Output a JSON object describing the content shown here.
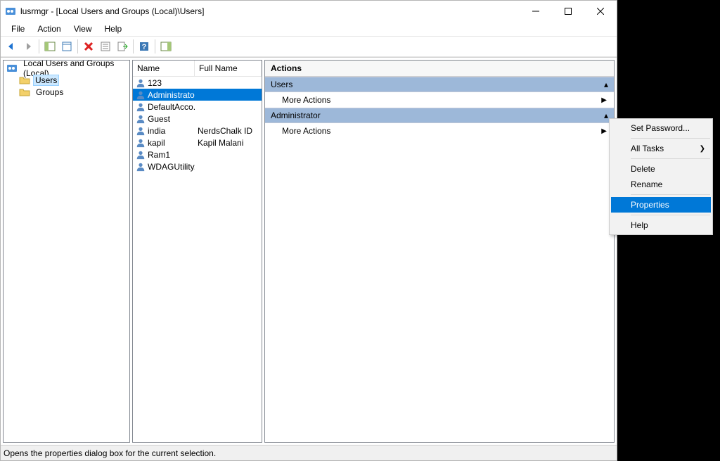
{
  "window_title": "lusrmgr - [Local Users and Groups (Local)\\Users]",
  "menu": {
    "file": "File",
    "action": "Action",
    "view": "View",
    "help": "Help"
  },
  "tree": {
    "root": "Local Users and Groups (Local)",
    "users": "Users",
    "groups": "Groups"
  },
  "list": {
    "headers": {
      "name": "Name",
      "full_name": "Full Name"
    },
    "rows": [
      {
        "name": "123",
        "full": ""
      },
      {
        "name": "Administrator",
        "full": ""
      },
      {
        "name": "DefaultAcco...",
        "full": ""
      },
      {
        "name": "Guest",
        "full": ""
      },
      {
        "name": "india",
        "full": "NerdsChalk ID"
      },
      {
        "name": "kapil",
        "full": "Kapil Malani"
      },
      {
        "name": "Ram1",
        "full": ""
      },
      {
        "name": "WDAGUtility...",
        "full": ""
      }
    ]
  },
  "actions": {
    "title": "Actions",
    "section_users": "Users",
    "section_admin": "Administrator",
    "more_actions": "More Actions"
  },
  "context_menu": {
    "set_password": "Set Password...",
    "all_tasks": "All Tasks",
    "delete": "Delete",
    "rename": "Rename",
    "properties": "Properties",
    "help": "Help"
  },
  "statusbar": "Opens the properties dialog box for the current selection."
}
